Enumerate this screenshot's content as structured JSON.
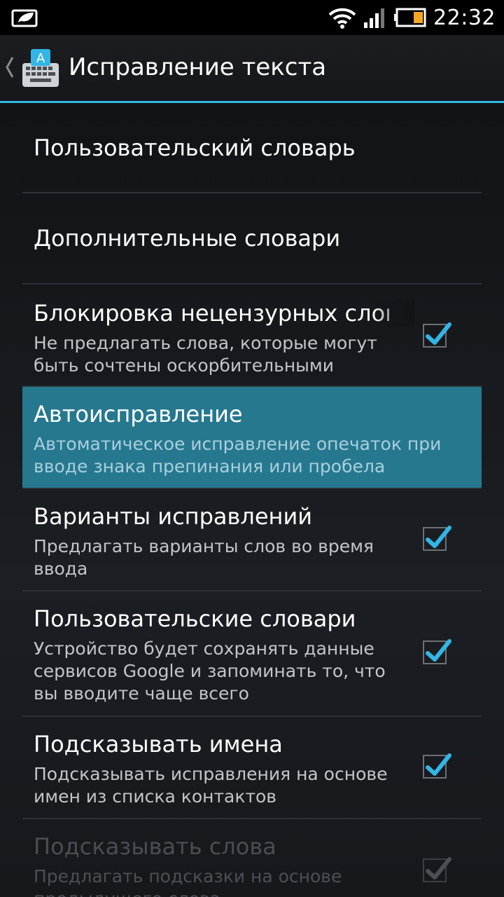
{
  "status_bar": {
    "time": "22:32"
  },
  "action_bar": {
    "title": "Исправление текста"
  },
  "colors": {
    "accent": "#33b5e5",
    "selected_row": "#26788f"
  },
  "settings": {
    "user_dictionary": {
      "title": "Пользовательский словарь"
    },
    "add_on_dictionaries": {
      "title": "Дополнительные словари"
    },
    "block_offensive": {
      "title": "Блокировка нецензурных слов",
      "summary": "Не предлагать слова, которые могут быть сочтены оскорбительными",
      "checked": true
    },
    "auto_correction": {
      "title": "Автоисправление",
      "summary": "Автоматическое исправление опечаток при вводе знака препинания или пробела"
    },
    "show_suggestions": {
      "title": "Варианты исправлений",
      "summary": "Предлагать варианты слов во время ввода",
      "checked": true
    },
    "personalized": {
      "title": "Пользовательские словари",
      "summary": "Устройство будет сохранять данные сервисов Google и запоминать то, что вы вводите чаще всего",
      "checked": true
    },
    "contact_names": {
      "title": "Подсказывать имена",
      "summary": "Подсказывать исправления на основе имен из списка контактов",
      "checked": true
    },
    "next_word": {
      "title": "Подсказывать слова",
      "summary": "Предлагать подсказки на основе предыдущего слова",
      "checked": true,
      "enabled": false
    }
  }
}
